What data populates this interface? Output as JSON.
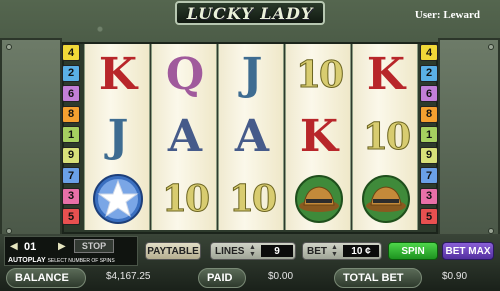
{
  "title": "LUCKY LADY",
  "user": {
    "label": "User:",
    "name": "Leward"
  },
  "paylines_left": [
    {
      "n": "4",
      "color": "#f0d838"
    },
    {
      "n": "2",
      "color": "#5ab0e6"
    },
    {
      "n": "6",
      "color": "#c27fd8"
    },
    {
      "n": "8",
      "color": "#f5a030"
    },
    {
      "n": "1",
      "color": "#a6d060"
    },
    {
      "n": "9",
      "color": "#d8e07a"
    },
    {
      "n": "7",
      "color": "#6aa0e8"
    },
    {
      "n": "3",
      "color": "#e870a8"
    },
    {
      "n": "5",
      "color": "#e85050"
    }
  ],
  "paylines_right": [
    {
      "n": "4",
      "color": "#f0d838"
    },
    {
      "n": "2",
      "color": "#5ab0e6"
    },
    {
      "n": "6",
      "color": "#c27fd8"
    },
    {
      "n": "8",
      "color": "#f5a030"
    },
    {
      "n": "1",
      "color": "#a6d060"
    },
    {
      "n": "9",
      "color": "#d8e07a"
    },
    {
      "n": "7",
      "color": "#6aa0e8"
    },
    {
      "n": "3",
      "color": "#e870a8"
    },
    {
      "n": "5",
      "color": "#e85050"
    }
  ],
  "reels": [
    [
      "K",
      "J",
      "star"
    ],
    [
      "Q",
      "A",
      "10"
    ],
    [
      "J",
      "A",
      "10"
    ],
    [
      "10",
      "K",
      "hat"
    ],
    [
      "K",
      "10",
      "hat"
    ]
  ],
  "autoplay": {
    "count": "01",
    "stop_label": "STOP",
    "label": "AUTOPLAY",
    "sublabel": "SELECT NUMBER OF SPINS"
  },
  "controls": {
    "paytable_label": "PAYTABLE",
    "lines_label": "LINES",
    "lines_value": "9",
    "bet_label": "BET",
    "bet_value": "10 ¢",
    "spin_label": "SPIN",
    "betmax_label": "BET MAX"
  },
  "stats": {
    "balance_label": "BALANCE",
    "balance_value": "$4,167.25",
    "paid_label": "PAID",
    "paid_value": "$0.00",
    "total_bet_label": "TOTAL BET",
    "total_bet_value": "$0.90"
  }
}
